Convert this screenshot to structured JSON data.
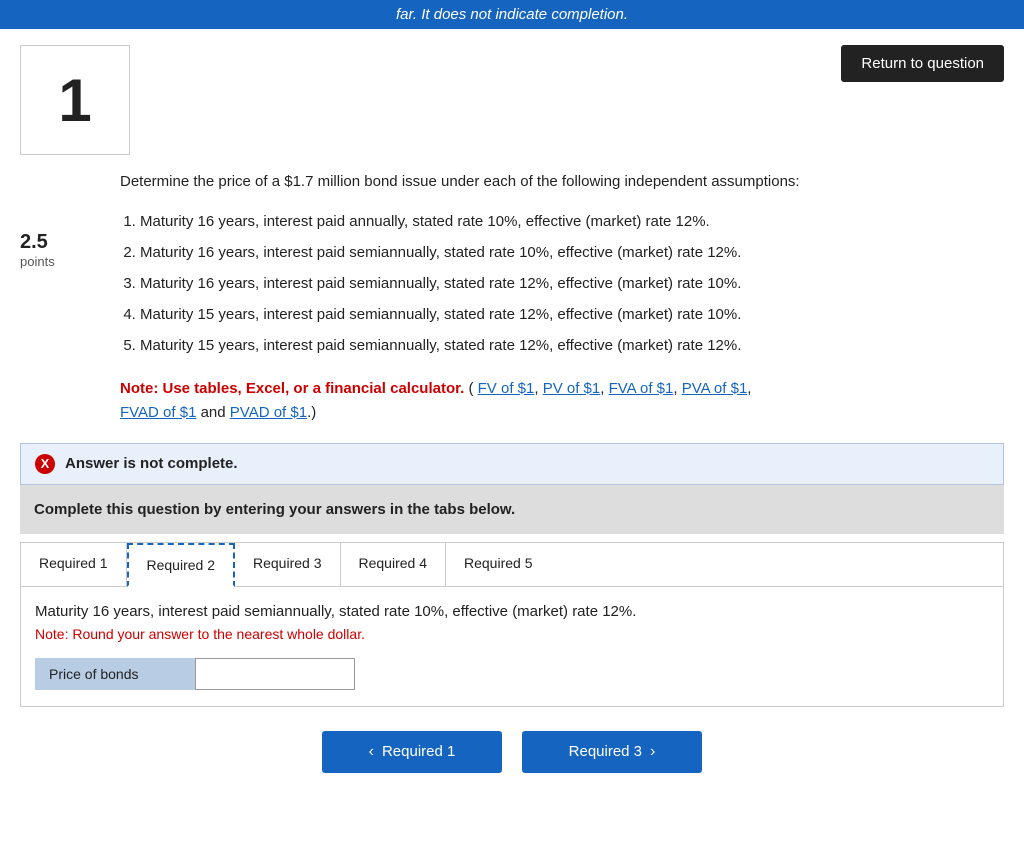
{
  "topbar": {
    "text": "far. It does not indicate completion."
  },
  "header": {
    "question_number": "1",
    "return_button_label": "Return to question"
  },
  "points": {
    "value": "2.5",
    "label": "points"
  },
  "question": {
    "intro": "Determine the price of a $1.7 million bond issue under each of the following independent assumptions:",
    "assumptions": [
      "Maturity 16 years, interest paid annually, stated rate 10%, effective (market) rate 12%.",
      "Maturity 16 years, interest paid semiannually, stated rate 10%, effective (market) rate 12%.",
      "Maturity 16 years, interest paid semiannually, stated rate 12%, effective (market) rate 10%.",
      "Maturity 15 years, interest paid semiannually, stated rate 12%, effective (market) rate 10%.",
      "Maturity 15 years, interest paid semiannually, stated rate 12%, effective (market) rate 12%."
    ]
  },
  "note": {
    "bold_part": "Note: Use tables, Excel, or a financial calculator.",
    "links": [
      "FV of $1",
      "PV of $1",
      "FVA of $1",
      "PVA of $1",
      "FVAD of $1",
      "PVAD of $1"
    ],
    "and_text": "and",
    "period": "."
  },
  "answer_banner": {
    "icon_label": "X",
    "text": "Answer is not complete."
  },
  "complete_instruction": {
    "text": "Complete this question by entering your answers in the tabs below."
  },
  "tabs": [
    {
      "label": "Required 1",
      "active": false
    },
    {
      "label": "Required 2",
      "active": true
    },
    {
      "label": "Required 3",
      "active": false
    },
    {
      "label": "Required 4",
      "active": false
    },
    {
      "label": "Required 5",
      "active": false
    }
  ],
  "tab_content": {
    "description": "Maturity 16 years, interest paid semiannually, stated rate 10%, effective (market) rate 12%.",
    "note": "Note: Round your answer to the nearest whole dollar.",
    "input_label": "Price of bonds",
    "input_placeholder": ""
  },
  "bottom_nav": {
    "prev_label": "Required 1",
    "next_label": "Required 3",
    "prev_arrow": "‹",
    "next_arrow": "›"
  }
}
